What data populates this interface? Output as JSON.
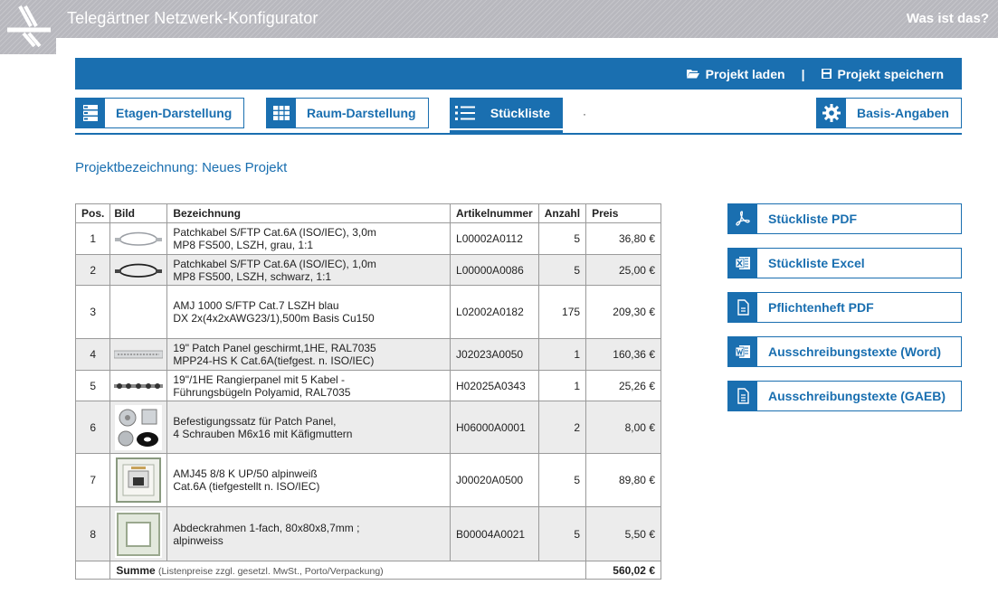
{
  "header": {
    "title": "Telegärtner Netzwerk-Konfigurator",
    "help": "Was ist das?"
  },
  "topbar": {
    "load": "Projekt laden",
    "separator": "|",
    "save": "Projekt speichern"
  },
  "tabs": [
    {
      "label": "Etagen-Darstellung",
      "icon": "floors-icon"
    },
    {
      "label": "Raum-Darstellung",
      "icon": "room-grid-icon"
    },
    {
      "label": "Stückliste",
      "icon": "list-icon",
      "active": true
    },
    {
      "label": "Basis-Angaben",
      "icon": "gear-icon"
    }
  ],
  "tab_dot": "·",
  "project": {
    "label": "Projektbezeichnung: Neues Projekt"
  },
  "table": {
    "headers": [
      "Pos.",
      "Bild",
      "Bezeichnung",
      "Artikelnummer",
      "Anzahl",
      "Preis"
    ],
    "rows": [
      {
        "pos": "1",
        "image": "patch-cable-grey",
        "desc1": "Patchkabel S/FTP Cat.6A (ISO/IEC), 3,0m",
        "desc2": "MP8 FS500, LSZH, grau, 1:1",
        "article": "L00002A0112",
        "qty": "5",
        "price": "36,80 €"
      },
      {
        "pos": "2",
        "image": "patch-cable-black",
        "desc1": "Patchkabel S/FTP Cat.6A (ISO/IEC), 1,0m",
        "desc2": "MP8 FS500, LSZH, schwarz, 1:1",
        "article": "L00000A0086",
        "qty": "5",
        "price": "25,00 €"
      },
      {
        "pos": "3",
        "image": "",
        "desc1": "AMJ 1000 S/FTP Cat.7 LSZH blau",
        "desc2": "DX 2x(4x2xAWG23/1),500m Basis Cu150",
        "article": "L02002A0182",
        "qty": "175",
        "price": "209,30 €"
      },
      {
        "pos": "4",
        "image": "patch-panel",
        "desc1": "19\" Patch Panel geschirmt,1HE, RAL7035",
        "desc2": "MPP24-HS K Cat.6A(tiefgest. n. ISO/IEC)",
        "article": "J02023A0050",
        "qty": "1",
        "price": "160,36 €"
      },
      {
        "pos": "5",
        "image": "cable-management-panel",
        "desc1": "19\"/1HE Rangierpanel mit 5 Kabel -",
        "desc2": "Führungsbügeln Polyamid, RAL7035",
        "article": "H02025A0343",
        "qty": "1",
        "price": "25,26 €"
      },
      {
        "pos": "6",
        "image": "mounting-screws",
        "desc1": "Befestigungssatz für Patch Panel,",
        "desc2": "4 Schrauben M6x16 mit Käfigmuttern",
        "article": "H06000A0001",
        "qty": "2",
        "price": "8,00 €"
      },
      {
        "pos": "7",
        "image": "wall-socket",
        "desc1": "AMJ45 8/8 K UP/50 alpinweiß",
        "desc2": "Cat.6A (tiefgestellt n. ISO/IEC)",
        "article": "J00020A0500",
        "qty": "5",
        "price": "89,80 €"
      },
      {
        "pos": "8",
        "image": "cover-frame",
        "desc1": "Abdeckrahmen 1-fach, 80x80x8,7mm ;",
        "desc2": "alpinweiss",
        "article": "B00004A0021",
        "qty": "5",
        "price": "5,50 €"
      }
    ],
    "sum_label": "Summe",
    "sum_note": "(Listenpreise zzgl. gesetzl. MwSt., Porto/Verpackung)",
    "sum_value": "560,02 €"
  },
  "downloads": [
    {
      "label": "Stückliste PDF",
      "icon": "pdf-icon"
    },
    {
      "label": "Stückliste Excel",
      "icon": "excel-icon"
    },
    {
      "label": "Pflichtenheft PDF",
      "icon": "document-icon"
    },
    {
      "label": "Ausschreibungstexte (Word)",
      "icon": "word-icon"
    },
    {
      "label": "Ausschreibungstexte (GAEB)",
      "icon": "gaeb-document-icon"
    }
  ],
  "colors": {
    "accent": "#1a6fb0",
    "header_bg": "#b8b8be",
    "row_alt": "#ececec"
  }
}
